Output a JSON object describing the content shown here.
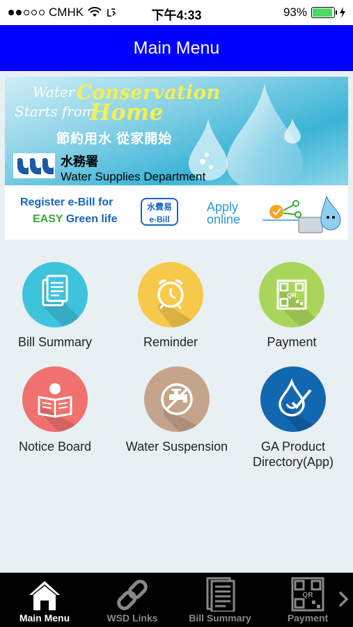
{
  "status_bar": {
    "carrier": "CMHK",
    "time": "下午4:33",
    "battery": "93%",
    "battery_level": 0.93,
    "signal_bars": 2
  },
  "header": {
    "title": "Main Menu",
    "background": "#0000ff"
  },
  "banner": {
    "water": "Water",
    "conservation": "Conservation",
    "starts_from": "Starts from",
    "home": "Home",
    "chinese_slogan": "節約用水 從家開始",
    "dept_zh": "水務署",
    "dept_en": "Water Supplies Department",
    "ebill_line1": "Register e-Bill for",
    "ebill_easy": "EASY",
    "ebill_line2": " Green life",
    "water_fee_zh": "水費易",
    "water_fee_en": "e-Bill",
    "apply_line1": "Apply",
    "apply_line2": "online"
  },
  "menu": [
    {
      "label": "Bill Summary",
      "color": "#3ec3dd",
      "icon": "bill-icon"
    },
    {
      "label": "Reminder",
      "color": "#f7c94a",
      "icon": "alarm-clock-icon"
    },
    {
      "label": "Payment",
      "color": "#a9d65a",
      "icon": "qr-code-icon"
    },
    {
      "label": "Notice Board",
      "color": "#f0716e",
      "icon": "reader-icon"
    },
    {
      "label": "Water Suspension",
      "color": "#c4a48a",
      "icon": "no-water-tap-icon"
    },
    {
      "label": "GA Product Directory(App)",
      "label_line1": "GA Product",
      "label_line2": "Directory(App)",
      "color": "#1268b0",
      "icon": "water-drop-check-icon"
    }
  ],
  "tabs": [
    {
      "label": "Main Menu",
      "icon": "home-icon",
      "active": true
    },
    {
      "label": "WSD Links",
      "icon": "link-icon",
      "active": false
    },
    {
      "label": "Bill Summary",
      "icon": "document-icon",
      "active": false
    },
    {
      "label": "Payment",
      "icon": "qr-code-icon",
      "active": false
    }
  ]
}
